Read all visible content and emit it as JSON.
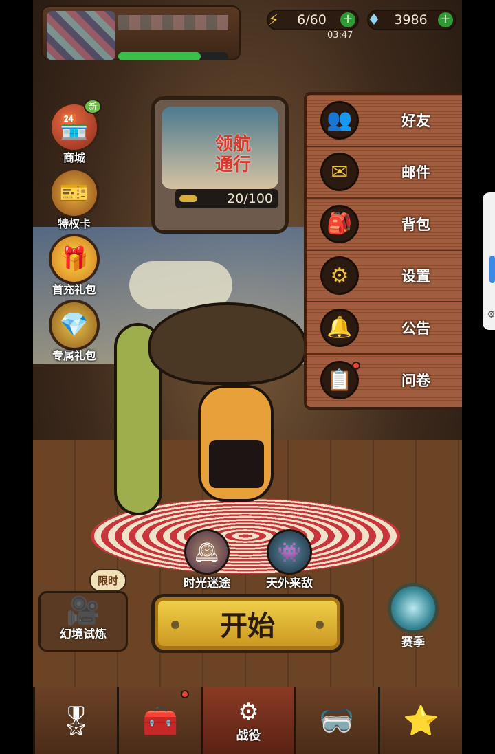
{
  "resources": {
    "energy": "6/60",
    "gems": "3986",
    "time": "03:47",
    "plus": "+"
  },
  "player": {
    "xp_fraction": 0.75
  },
  "side_menu": [
    {
      "label": "商城",
      "icon": "shop-icon",
      "badge": "新"
    },
    {
      "label": "特权卡",
      "icon": "privilege-card-icon"
    },
    {
      "label": "首充礼包",
      "icon": "gift-box-icon"
    },
    {
      "label": "专属礼包",
      "icon": "treasure-chest-icon"
    }
  ],
  "tv": {
    "title_line1": "领航",
    "title_line2": "通行",
    "progress": "20/100",
    "progress_fraction": 0.2
  },
  "modes": [
    {
      "label": "时光迷途",
      "icon": "time-journey-icon"
    },
    {
      "label": "天外来敌",
      "icon": "alien-enemy-icon"
    }
  ],
  "trial": {
    "label": "幻境试炼",
    "tag": "限时",
    "icon": "film-camera-icon"
  },
  "start_button": "开始",
  "season": {
    "label": "赛季",
    "icon": "season-portal-icon"
  },
  "dropdown_menu": [
    {
      "label": "好友",
      "icon": "friends-icon"
    },
    {
      "label": "邮件",
      "icon": "mail-icon"
    },
    {
      "label": "背包",
      "icon": "backpack-icon"
    },
    {
      "label": "设置",
      "icon": "gear-icon"
    },
    {
      "label": "公告",
      "icon": "bell-icon"
    },
    {
      "label": "问卷",
      "icon": "survey-icon",
      "notification": true
    }
  ],
  "bottom_nav": [
    {
      "icon": "star-chest-icon"
    },
    {
      "icon": "lunchbox-icon",
      "notification": true
    },
    {
      "label": "战役",
      "icon": "campaign-icon",
      "active": true
    },
    {
      "icon": "goggles-icon"
    },
    {
      "icon": "star-frame-icon"
    }
  ],
  "colors": {
    "energy_icon": "#f2c33c",
    "gem_icon": "#8fd3f4",
    "plus": "#2e9a33",
    "notification": "#e7422e",
    "start_button": "#f2d24c",
    "menu_background": "#a35d3c"
  }
}
